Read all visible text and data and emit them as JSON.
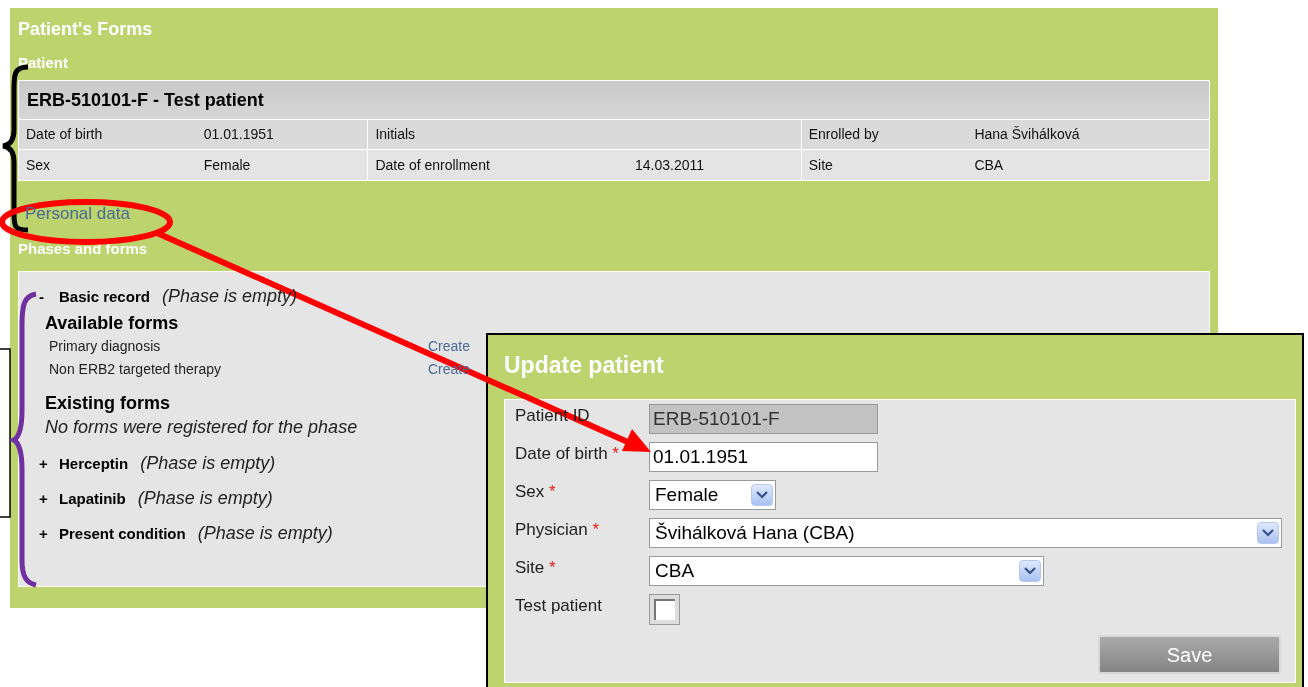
{
  "page": {
    "title": "Patient's Forms",
    "patient_heading": "Patient",
    "patient": {
      "title": "ERB-510101-F - Test patient",
      "rows": [
        [
          "Date of birth",
          "01.01.1951",
          "Initials",
          "",
          "Enrolled by",
          "Hana Švihálková"
        ],
        [
          "Sex",
          "Female",
          "Date of enrollment",
          "14.03.2011",
          "Site",
          "CBA"
        ]
      ]
    },
    "personal_data_link": "Personal data",
    "phases_heading": "Phases and forms",
    "phases": [
      {
        "sign": "-",
        "name": "Basic record",
        "status": "(Phase is empty)",
        "expanded": true,
        "available_heading": "Available forms",
        "available_forms": [
          {
            "name": "Primary diagnosis",
            "action": "Create"
          },
          {
            "name": "Non ERB2 targeted therapy",
            "action": "Create"
          }
        ],
        "existing_heading": "Existing forms",
        "existing_note": "No forms were registered for the phase"
      },
      {
        "sign": "+",
        "name": "Herceptin",
        "status": "(Phase is empty)",
        "expanded": false
      },
      {
        "sign": "+",
        "name": "Lapatinib",
        "status": "(Phase is empty)",
        "expanded": false
      },
      {
        "sign": "+",
        "name": "Present condition",
        "status": "(Phase is empty)",
        "expanded": false
      }
    ]
  },
  "dialog": {
    "title": "Update patient",
    "fields": [
      {
        "kind": "text",
        "label": "Patient ID",
        "value": "ERB-510101-F",
        "disabled": true
      },
      {
        "kind": "text",
        "label": "Date of birth",
        "mark": "*",
        "value": "01.01.1951",
        "disabled": false
      },
      {
        "kind": "select",
        "label": "Sex",
        "mark": "*",
        "value": "Female"
      },
      {
        "kind": "select",
        "label": "Physician",
        "mark": "*",
        "value": "Švihálková Hana (CBA)"
      },
      {
        "kind": "select",
        "label": "Site",
        "mark": "*",
        "value": "CBA"
      },
      {
        "kind": "checkbox",
        "label": "Test patient",
        "checked": false
      }
    ],
    "button": "Save"
  }
}
